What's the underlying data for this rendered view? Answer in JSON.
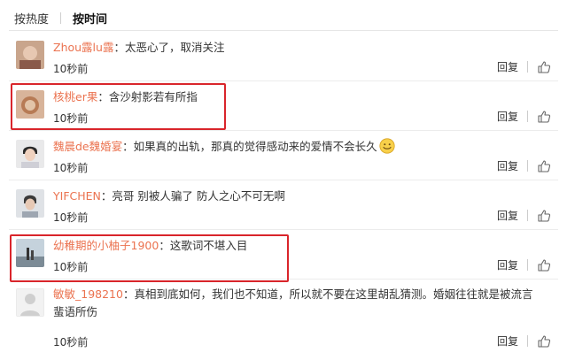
{
  "tabs": [
    {
      "label": "按热度",
      "active": false
    },
    {
      "label": "按时间",
      "active": true
    }
  ],
  "comments": [
    {
      "user": "Zhou露lu露",
      "text": "：太恶心了，取消关注",
      "time": "10秒前",
      "reply": "回复",
      "avatar": "photo-avatar"
    },
    {
      "user": "核桃er果",
      "text": "：含沙射影若有所指",
      "time": "10秒前",
      "reply": "回复",
      "avatar": "photo-avatar"
    },
    {
      "user": "魏晨de魏婚宴",
      "text": "：如果真的出轨，那真的觉得感动来的爱情不会长久",
      "time": "10秒前",
      "reply": "回复",
      "avatar": "photo-avatar",
      "emoji": "smile-emoji"
    },
    {
      "user": "YIFCHEN",
      "text": "：亮哥 别被人骗了 防人之心不可无啊",
      "time": "10秒前",
      "reply": "回复",
      "avatar": "photo-avatar"
    },
    {
      "user": "幼稚期的小柚子1900",
      "text": "：这歌词不堪入目",
      "time": "10秒前",
      "reply": "回复",
      "avatar": "photo-avatar"
    },
    {
      "user": "敏敏_198210",
      "text": "：真相到底如何，我们也不知道，所以就不要在这里胡乱猜测。婚姻往往就是被流言",
      "text2": "蜚语所伤",
      "time": "10秒前",
      "reply": "回复",
      "avatar": "default-avatar"
    }
  ],
  "colors": {
    "username": "#eb7350",
    "highlight_border": "#d9252b"
  },
  "icons": {
    "like": "thumbs-up-icon"
  }
}
